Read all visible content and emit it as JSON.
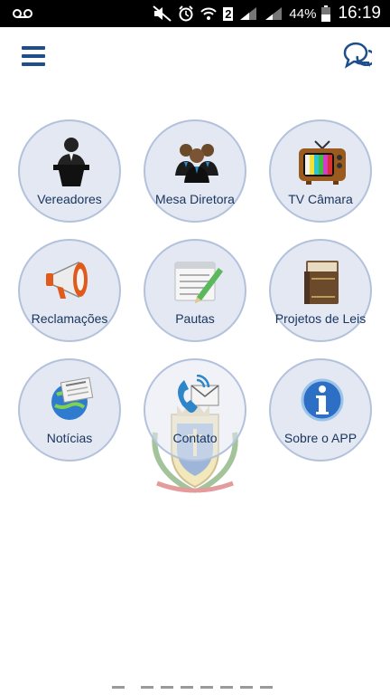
{
  "status_bar": {
    "battery_percent": "44%",
    "time": "16:19",
    "sim_number": "2"
  },
  "header": {
    "menu_icon": "hamburger-menu-icon",
    "chat_icon": "chat-bubbles-icon"
  },
  "colors": {
    "accent": "#1e4f8c",
    "tile_bg": "#e3e8f2",
    "tile_border": "#b3c2dc",
    "label": "#1a3660"
  },
  "menu": {
    "items": [
      {
        "label": "Vereadores",
        "icon": "speaker-podium-icon"
      },
      {
        "label": "Mesa Diretora",
        "icon": "board-people-icon"
      },
      {
        "label": "TV Câmara",
        "icon": "retro-tv-icon"
      },
      {
        "label": "Reclamações",
        "icon": "megaphone-icon"
      },
      {
        "label": "Pautas",
        "icon": "notepad-pencil-icon"
      },
      {
        "label": "Projetos de Leis",
        "icon": "law-books-icon"
      },
      {
        "label": "Notícias",
        "icon": "newspaper-globe-icon"
      },
      {
        "label": "Contato",
        "icon": "phone-mail-icon"
      },
      {
        "label": "Sobre o APP",
        "icon": "info-icon"
      }
    ]
  },
  "watermark": {
    "icon": "municipal-crest-icon"
  }
}
